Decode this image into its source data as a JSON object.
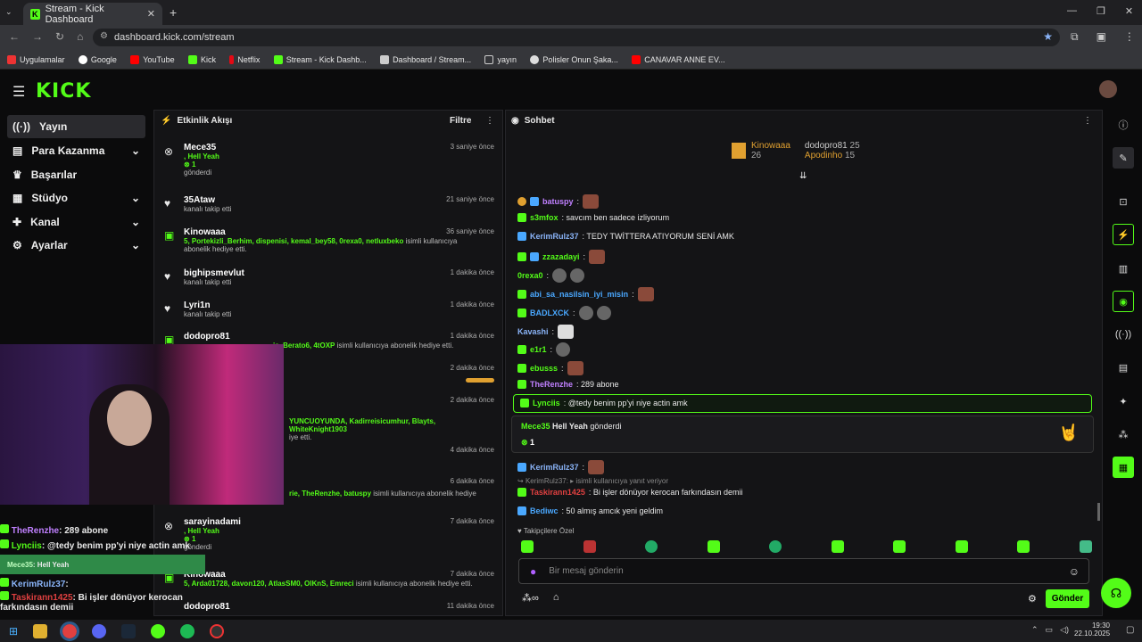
{
  "browser": {
    "tab_title": "Stream - Kick Dashboard",
    "url": "dashboard.kick.com/stream",
    "url_path": "/stream",
    "bookmarks": [
      "Uygulamalar",
      "Google",
      "YouTube",
      "Kick",
      "Netflix",
      "Stream - Kick Dashb...",
      "Dashboard / Stream...",
      "yayın",
      "Polisler Onun Şaka...",
      "CANAVAR ANNE EV..."
    ]
  },
  "sidebar": {
    "items": [
      {
        "label": "Yayın"
      },
      {
        "label": "Para Kazanma"
      },
      {
        "label": "Başarılar"
      },
      {
        "label": "Stüdyo"
      },
      {
        "label": "Kanal"
      },
      {
        "label": "Ayarlar"
      }
    ]
  },
  "activity": {
    "title": "Etkinlik Akışı",
    "filter": "Filtre",
    "events": [
      {
        "name": "Mece35",
        "line1": ", Hell Yeah",
        "line2": "1",
        "line3": "gönderdi",
        "time": "3 saniye önce"
      },
      {
        "name": "35Ataw",
        "line1": "kanalı takip etti",
        "time": "21 saniye önce"
      },
      {
        "name": "Kinowaaa",
        "line1": "5, Portekizli_Berhim, dispenisi, kemal_bey58, 0rexa0, netluxbeko",
        "line1b": "isimli kullanıcıya",
        "line2": "abonelik hediye etti.",
        "time": "36 saniye önce"
      },
      {
        "name": "bighipsmevlut",
        "line1": "kanalı takip etti",
        "time": "1 dakika önce"
      },
      {
        "name": "Lyri1n",
        "line1": "kanalı takip etti",
        "time": "1 dakika önce"
      },
      {
        "name": "dodopro81",
        "line1": "is, Berato6, 4tOXP",
        "line1b": "isimli kullanıcıya abonelik hediye etti.",
        "time": "1 dakika önce"
      },
      {
        "time": "2 dakika önce"
      },
      {
        "line1": "YUNCUOYUNDA, Kadirreisicumhur, Blayts, WhiteKnight1903",
        "line2": "iye etti.",
        "time": "2 dakika önce"
      },
      {
        "time": "4 dakika önce"
      },
      {
        "line1": "rie, TheRenzhe, batuspy",
        "line1b": "isimli kullanıcıya abonelik hediye",
        "time": "6 dakika önce"
      },
      {
        "name": "sarayinadami",
        "line1": ", Hell Yeah",
        "line2": "1",
        "line3": "gönderdi",
        "time": "7 dakika önce"
      },
      {
        "name": "Kinowaaa",
        "line1": "5, Arda01728, davon120, AtlasSM0, OlKnS, Emreci",
        "line1b": "isimli kullanıcıya abonelik hediye etti.",
        "time": "7 dakika önce"
      },
      {
        "name": "dodopro81",
        "time": "11 dakika önce"
      }
    ]
  },
  "chat": {
    "title": "Sohbet",
    "leaders": [
      {
        "name": "Kinowaaa",
        "count": "26"
      },
      {
        "name": "dodopro81",
        "count": "25"
      },
      {
        "name": "Apodinho",
        "count": "15"
      }
    ],
    "messages": [
      {
        "user": "batuspy",
        "text": ":"
      },
      {
        "user": "s3mfox",
        "text": ": savcım ben sadece izliyorum"
      },
      {
        "user": "KerimRulz37",
        "text": ": TEDY TWİTTERA ATIYORUM SENİ AMK"
      },
      {
        "user": "zzazadayi",
        "text": ":"
      },
      {
        "user": "0rexa0",
        "text": ":"
      },
      {
        "user": "abi_sa_nasilsin_iyi_misin",
        "text": ":"
      },
      {
        "user": "BADLXCK",
        "text": ":"
      },
      {
        "user": "Kavashi",
        "text": ":"
      },
      {
        "user": "e1r1",
        "text": ":"
      },
      {
        "user": "ebusss",
        "text": ":"
      },
      {
        "user": "TheRenzhe",
        "text": ": 289 abone"
      },
      {
        "user": "Lynciis",
        "text": ": @tedy benim pp'yi niye actin amk"
      },
      {
        "user": "KerimRulz37",
        "text": ":"
      },
      {
        "user": "Taskirann1425",
        "text": ": Bi işler dönüyor kerocan farkındasın demii"
      },
      {
        "user": "Bediwc",
        "text": ": 50 almış amcık yeni geldim"
      }
    ],
    "kicks": {
      "user": "Mece35",
      "label": "Hell Yeah",
      "suffix": "gönderdi",
      "count": "1"
    },
    "reply": {
      "text": "KerimRulz37:",
      "hint": "isimli kullanıcıya yanıt veriyor"
    },
    "follower_only": "Takipçilere Özel",
    "input_placeholder": "Bir mesaj gönderin",
    "send": "Gönder"
  },
  "overlay": {
    "lines": [
      {
        "user": "TheRenzhe",
        "text": ": 289 abone"
      },
      {
        "user": "Lynciis",
        "text": ": @tedy benim pp'yi niye actin amk"
      },
      {
        "user": "Mece35",
        "text": ": Hell Yeah"
      },
      {
        "user": "KerimRulz37",
        "text": ":"
      },
      {
        "user": "Taskirann1425",
        "text": ": Bi işler dönüyor kerocan farkındasın demii"
      }
    ]
  },
  "taskbar": {
    "time": "19:30",
    "date": "22.10.2025"
  },
  "colors": {
    "accent": "#53fc18",
    "bg": "#0b0b0c",
    "panel": "#141416"
  }
}
